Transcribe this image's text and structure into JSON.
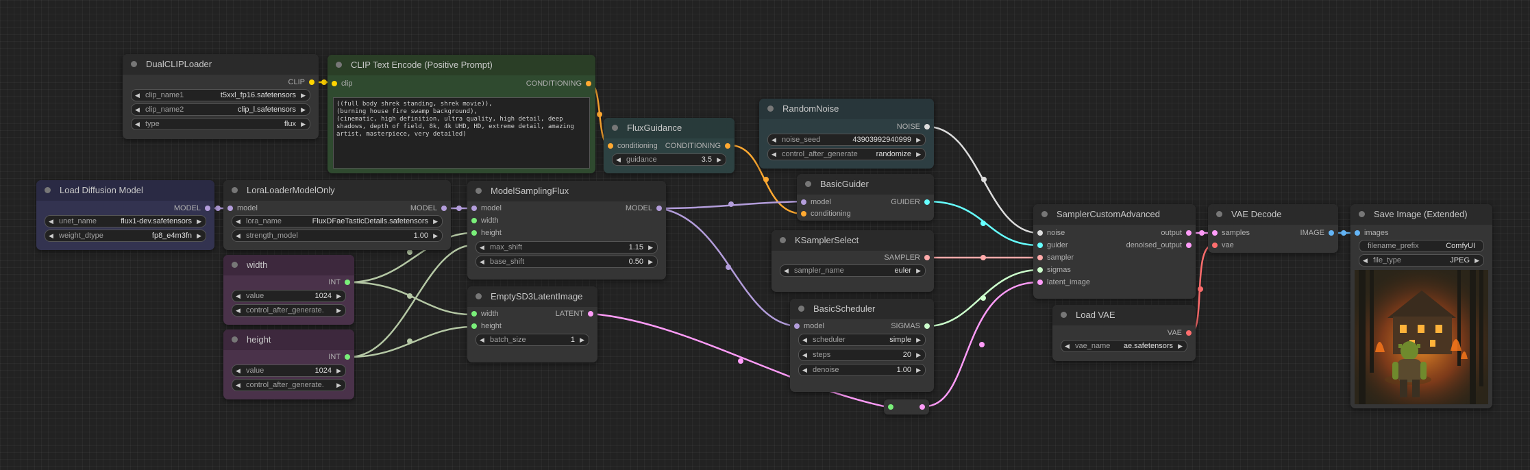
{
  "colors": {
    "clip": "#ffd500",
    "conditioning": "#ffa931",
    "model": "#b39ddb",
    "int": "#7aef7a",
    "latent": "#ff9cf9",
    "noise": "#dddddd",
    "guider": "#66ffff",
    "sampler": "#ffaaaa",
    "sigmas": "#ccffcc",
    "vae": "#ff6e6e",
    "image": "#64b5f6"
  },
  "nodes": {
    "dual_clip_loader": {
      "title": "DualCLIPLoader",
      "out_clip": "CLIP",
      "clip_name1_label": "clip_name1",
      "clip_name1_value": "t5xxl_fp16.safetensors",
      "clip_name2_label": "clip_name2",
      "clip_name2_value": "clip_l.safetensors",
      "type_label": "type",
      "type_value": "flux"
    },
    "clip_text_encode": {
      "title": "CLIP Text Encode (Positive Prompt)",
      "in_clip": "clip",
      "out_conditioning": "CONDITIONING",
      "text": "((full body shrek standing, shrek movie)),\n(burning house fire swamp background),\n(cinematic, high definition, ultra quality, high detail, deep shadows, depth of field, 8k, 4k UHD, HD, extreme detail, amazing artist, masterpiece, very detailed)"
    },
    "flux_guidance": {
      "title": "FluxGuidance",
      "in_conditioning": "conditioning",
      "out_conditioning": "CONDITIONING",
      "guidance_label": "guidance",
      "guidance_value": "3.5"
    },
    "random_noise": {
      "title": "RandomNoise",
      "out_noise": "NOISE",
      "noise_seed_label": "noise_seed",
      "noise_seed_value": "43903992940999",
      "control_label": "control_after_generate",
      "control_value": "randomize"
    },
    "basic_guider": {
      "title": "BasicGuider",
      "in_model": "model",
      "in_conditioning": "conditioning",
      "out_guider": "GUIDER"
    },
    "ksampler_select": {
      "title": "KSamplerSelect",
      "out_sampler": "SAMPLER",
      "sampler_name_label": "sampler_name",
      "sampler_name_value": "euler"
    },
    "basic_scheduler": {
      "title": "BasicScheduler",
      "in_model": "model",
      "out_sigmas": "SIGMAS",
      "scheduler_label": "scheduler",
      "scheduler_value": "simple",
      "steps_label": "steps",
      "steps_value": "20",
      "denoise_label": "denoise",
      "denoise_value": "1.00"
    },
    "load_diffusion_model": {
      "title": "Load Diffusion Model",
      "out_model": "MODEL",
      "unet_name_label": "unet_name",
      "unet_name_value": "flux1-dev.safetensors",
      "weight_dtype_label": "weight_dtype",
      "weight_dtype_value": "fp8_e4m3fn"
    },
    "lora_loader": {
      "title": "LoraLoaderModelOnly",
      "in_model": "model",
      "out_model": "MODEL",
      "lora_name_label": "lora_name",
      "lora_name_value": "FluxDFaeTasticDetails.safetensors",
      "strength_label": "strength_model",
      "strength_value": "1.00"
    },
    "model_sampling_flux": {
      "title": "ModelSamplingFlux",
      "in_model": "model",
      "in_width": "width",
      "in_height": "height",
      "out_model": "MODEL",
      "max_shift_label": "max_shift",
      "max_shift_value": "1.15",
      "base_shift_label": "base_shift",
      "base_shift_value": "0.50"
    },
    "width": {
      "title": "width",
      "out_int": "INT",
      "value_label": "value",
      "value_value": "1024",
      "control_label": "control_after_generate."
    },
    "height": {
      "title": "height",
      "out_int": "INT",
      "value_label": "value",
      "value_value": "1024",
      "control_label": "control_after_generate."
    },
    "empty_latent": {
      "title": "EmptySD3LatentImage",
      "in_width": "width",
      "in_height": "height",
      "out_latent": "LATENT",
      "batch_size_label": "batch_size",
      "batch_size_value": "1"
    },
    "sampler_custom_advanced": {
      "title": "SamplerCustomAdvanced",
      "in_noise": "noise",
      "in_guider": "guider",
      "in_sampler": "sampler",
      "in_sigmas": "sigmas",
      "in_latent": "latent_image",
      "out_output": "output",
      "out_denoised": "denoised_output"
    },
    "vae_decode": {
      "title": "VAE Decode",
      "in_samples": "samples",
      "in_vae": "vae",
      "out_image": "IMAGE"
    },
    "load_vae": {
      "title": "Load VAE",
      "out_vae": "VAE",
      "vae_name_label": "vae_name",
      "vae_name_value": "ae.safetensors"
    },
    "save_image": {
      "title": "Save Image (Extended)",
      "in_images": "images",
      "filename_prefix_label": "filename_prefix",
      "filename_prefix_value": "ComfyUI",
      "file_type_label": "file_type",
      "file_type_value": "JPEG"
    }
  }
}
